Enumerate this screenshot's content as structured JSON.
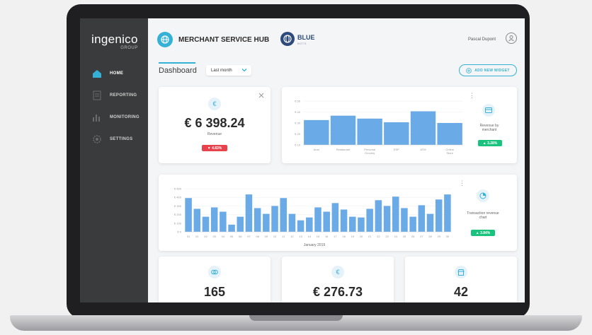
{
  "app": {
    "brand": "ingenico",
    "brand_sub": "GROUP",
    "hub_title": "MERCHANT SERVICE HUB",
    "partner": "BLUE",
    "partner_sub": "BOTS"
  },
  "user": {
    "name": "Pascal Dupont"
  },
  "sidebar": {
    "items": [
      {
        "label": "HOME",
        "icon": "home-icon",
        "active": true
      },
      {
        "label": "REPORTING",
        "icon": "document-icon",
        "active": false
      },
      {
        "label": "MONITORING",
        "icon": "bar-chart-icon",
        "active": false
      },
      {
        "label": "SETTINGS",
        "icon": "gear-icon",
        "active": false
      }
    ]
  },
  "toolbar": {
    "tab": "Dashboard",
    "period": "Last month",
    "add_widget": "ADD NEW WIDGET"
  },
  "colors": {
    "accent": "#35b1d6",
    "sidebar": "#3a3b3d",
    "bar": "#6aaae6",
    "green": "#19c37d",
    "red": "#e8434c"
  },
  "revenue_card": {
    "icon": "euro-icon",
    "value": "€ 6 398.24",
    "label": "Revenue",
    "badge": "▼ 4.83%"
  },
  "card_bar": {
    "label": "Revenue by merchant",
    "badge": "▲ 3.28%",
    "icon": "card-icon"
  },
  "card_line": {
    "label": "Transaction revenue chart",
    "badge": "▲ 3.84%",
    "icon": "pie-icon",
    "caption": "January 2019"
  },
  "bottom_cards": [
    {
      "icon": "coins-icon",
      "value": "165"
    },
    {
      "icon": "euro-icon",
      "value": "€ 276.73"
    },
    {
      "icon": "store-icon",
      "value": "42"
    }
  ],
  "chart_data": [
    {
      "type": "bar",
      "categories": [
        "Auto",
        "Restaurant",
        "Personal Grocery",
        "ESP",
        "ATM",
        "Online Store"
      ],
      "values": [
        3.4,
        4.0,
        3.6,
        3.1,
        4.6,
        3.0
      ],
      "yticks": [
        "€ 10",
        "€ 20",
        "€ 30",
        "€ 40",
        "€ 50"
      ],
      "ylim": [
        0,
        6
      ]
    },
    {
      "type": "bar",
      "categories": [
        "31",
        "01",
        "02",
        "03",
        "04",
        "05",
        "06",
        "07",
        "08",
        "09",
        "10",
        "11",
        "12",
        "13",
        "14",
        "15",
        "16",
        "17",
        "18",
        "19",
        "20",
        "21",
        "22",
        "23",
        "24",
        "25",
        "26",
        "27",
        "28",
        "29",
        "30"
      ],
      "values": [
        4.7,
        3.2,
        2.1,
        3.4,
        2.8,
        1.0,
        2.1,
        5.2,
        3.3,
        2.5,
        3.6,
        4.7,
        2.5,
        1.6,
        2.0,
        3.4,
        2.8,
        4.0,
        3.1,
        2.1,
        2.0,
        3.2,
        4.4,
        3.6,
        4.9,
        3.3,
        2.1,
        3.7,
        2.5,
        4.5,
        5.2
      ],
      "yticks": [
        "€ 0",
        "€ 100",
        "€ 200",
        "€ 300",
        "€ 400",
        "€ 500"
      ],
      "ylim": [
        0,
        6
      ]
    }
  ]
}
